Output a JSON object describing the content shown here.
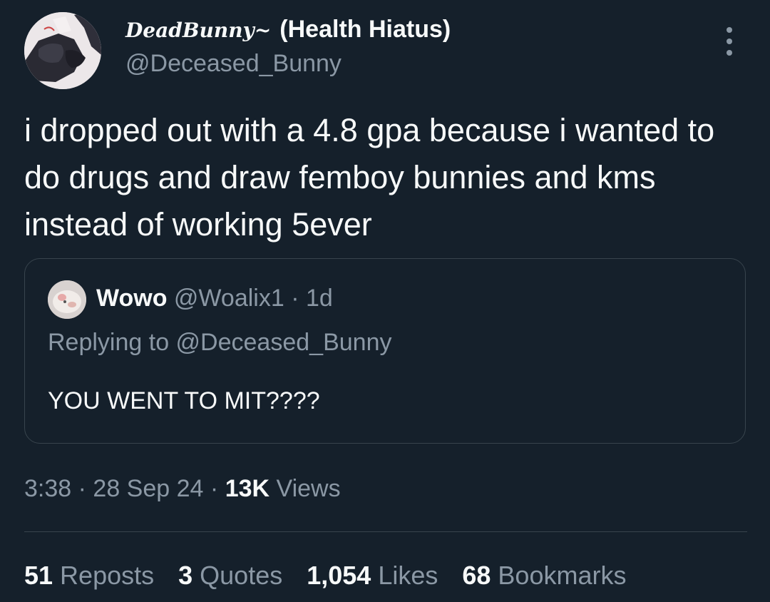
{
  "author": {
    "display_name_script": "DeadBunny~",
    "display_name_rest": "(Health Hiatus)",
    "handle": "@Deceased_Bunny"
  },
  "tweet": {
    "text": "i dropped out with a 4.8 gpa because i wanted to do drugs and draw femboy bunnies and kms instead of working 5ever"
  },
  "quote": {
    "name": "Wowo",
    "handle": "@Woalix1",
    "separator": "·",
    "time": "1d",
    "replying_to": "Replying to @Deceased_Bunny",
    "text": "YOU WENT TO MIT????"
  },
  "meta": {
    "time": "3:38",
    "separator": "·",
    "date": "28 Sep 24",
    "views_count": "13K",
    "views_label": "Views"
  },
  "stats": {
    "reposts": {
      "count": "51",
      "label": "Reposts"
    },
    "quotes": {
      "count": "3",
      "label": "Quotes"
    },
    "likes": {
      "count": "1,054",
      "label": "Likes"
    },
    "bookmarks": {
      "count": "68",
      "label": "Bookmarks"
    }
  },
  "colors": {
    "background": "#15202b",
    "text_primary": "#f7f9f9",
    "text_secondary": "#8b98a5",
    "border": "#38444d"
  }
}
